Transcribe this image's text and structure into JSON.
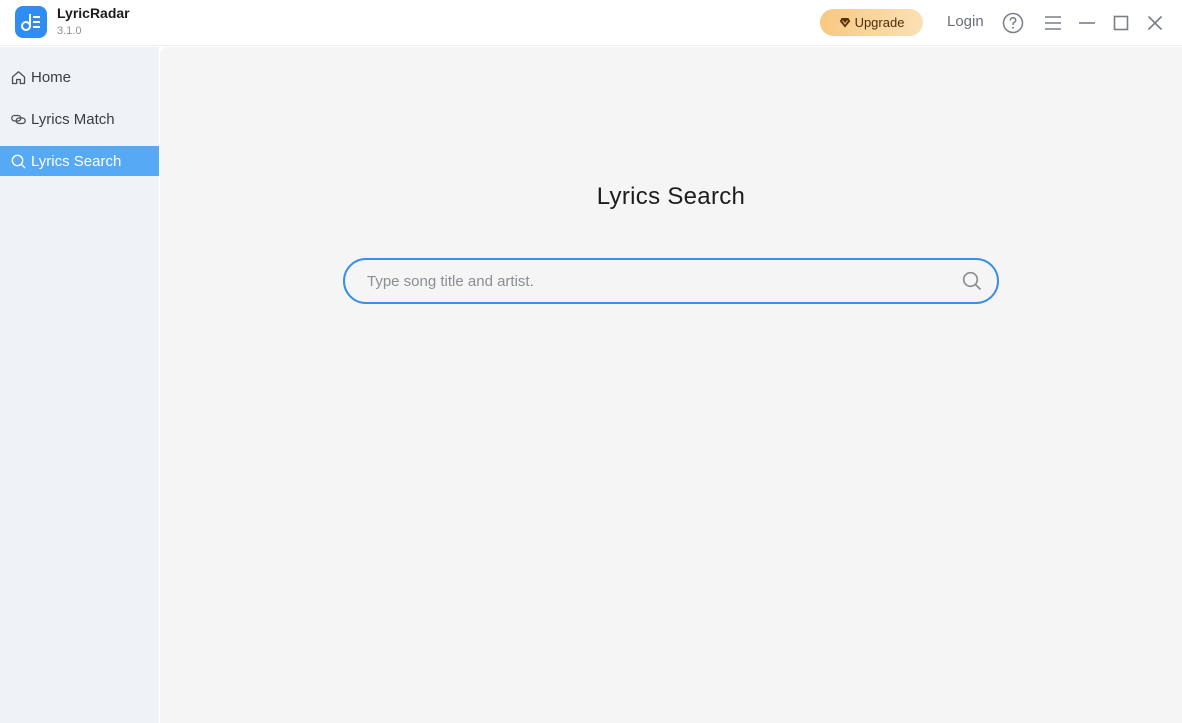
{
  "app": {
    "name": "LyricRadar",
    "version": "3.1.0",
    "accent_color": "#2f8cf0"
  },
  "titlebar": {
    "upgrade_label": "Upgrade",
    "login_label": "Login",
    "icons": [
      "help-icon",
      "menu-icon",
      "minimize-icon",
      "maximize-icon",
      "close-icon"
    ]
  },
  "sidebar": {
    "items": [
      {
        "label": "Home",
        "icon": "home-icon",
        "active": false
      },
      {
        "label": "Lyrics Match",
        "icon": "link-icon",
        "active": false
      },
      {
        "label": "Lyrics Search",
        "icon": "search-icon",
        "active": true
      }
    ],
    "active_color": "#55a9f5"
  },
  "main": {
    "title": "Lyrics Search",
    "search": {
      "placeholder": "Type song title and artist.",
      "value": ""
    }
  }
}
